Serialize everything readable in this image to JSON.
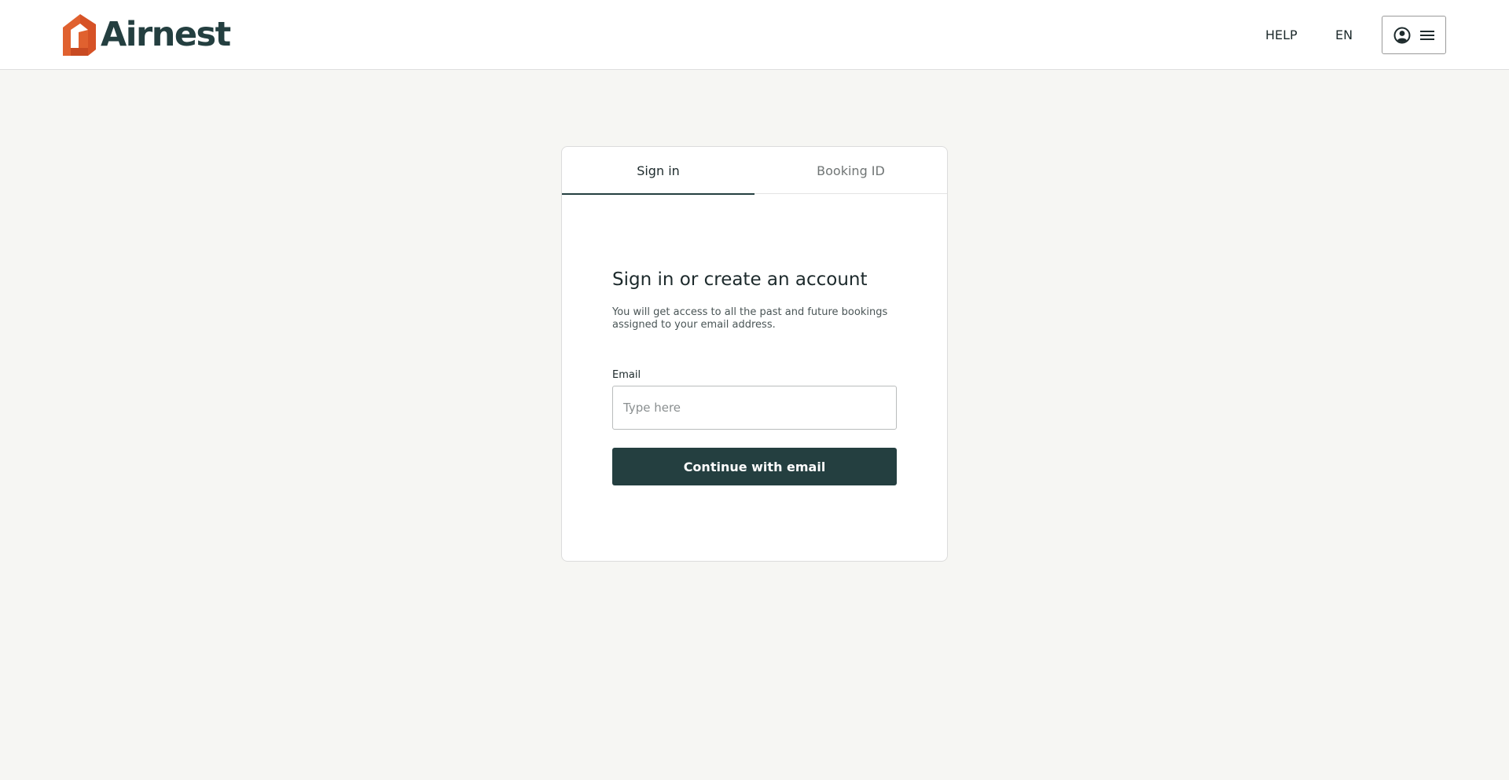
{
  "header": {
    "logo_text": "Airnest",
    "help_label": "HELP",
    "language_label": "EN",
    "menu_icons": [
      "user-circle-icon",
      "hamburger-menu-icon"
    ]
  },
  "tabs": [
    {
      "label": "Sign in",
      "active": true
    },
    {
      "label": "Booking ID",
      "active": false
    }
  ],
  "signin": {
    "title": "Sign in or create an account",
    "description": "You will get access to all the past and future bookings assigned to your email address.",
    "email_label": "Email",
    "email_value": "",
    "email_placeholder": "Type here",
    "continue_label": "Continue with email"
  },
  "colors": {
    "brand_dark": "#243f40",
    "brand_orange": "#e0612f",
    "background": "#f6f6f3"
  }
}
